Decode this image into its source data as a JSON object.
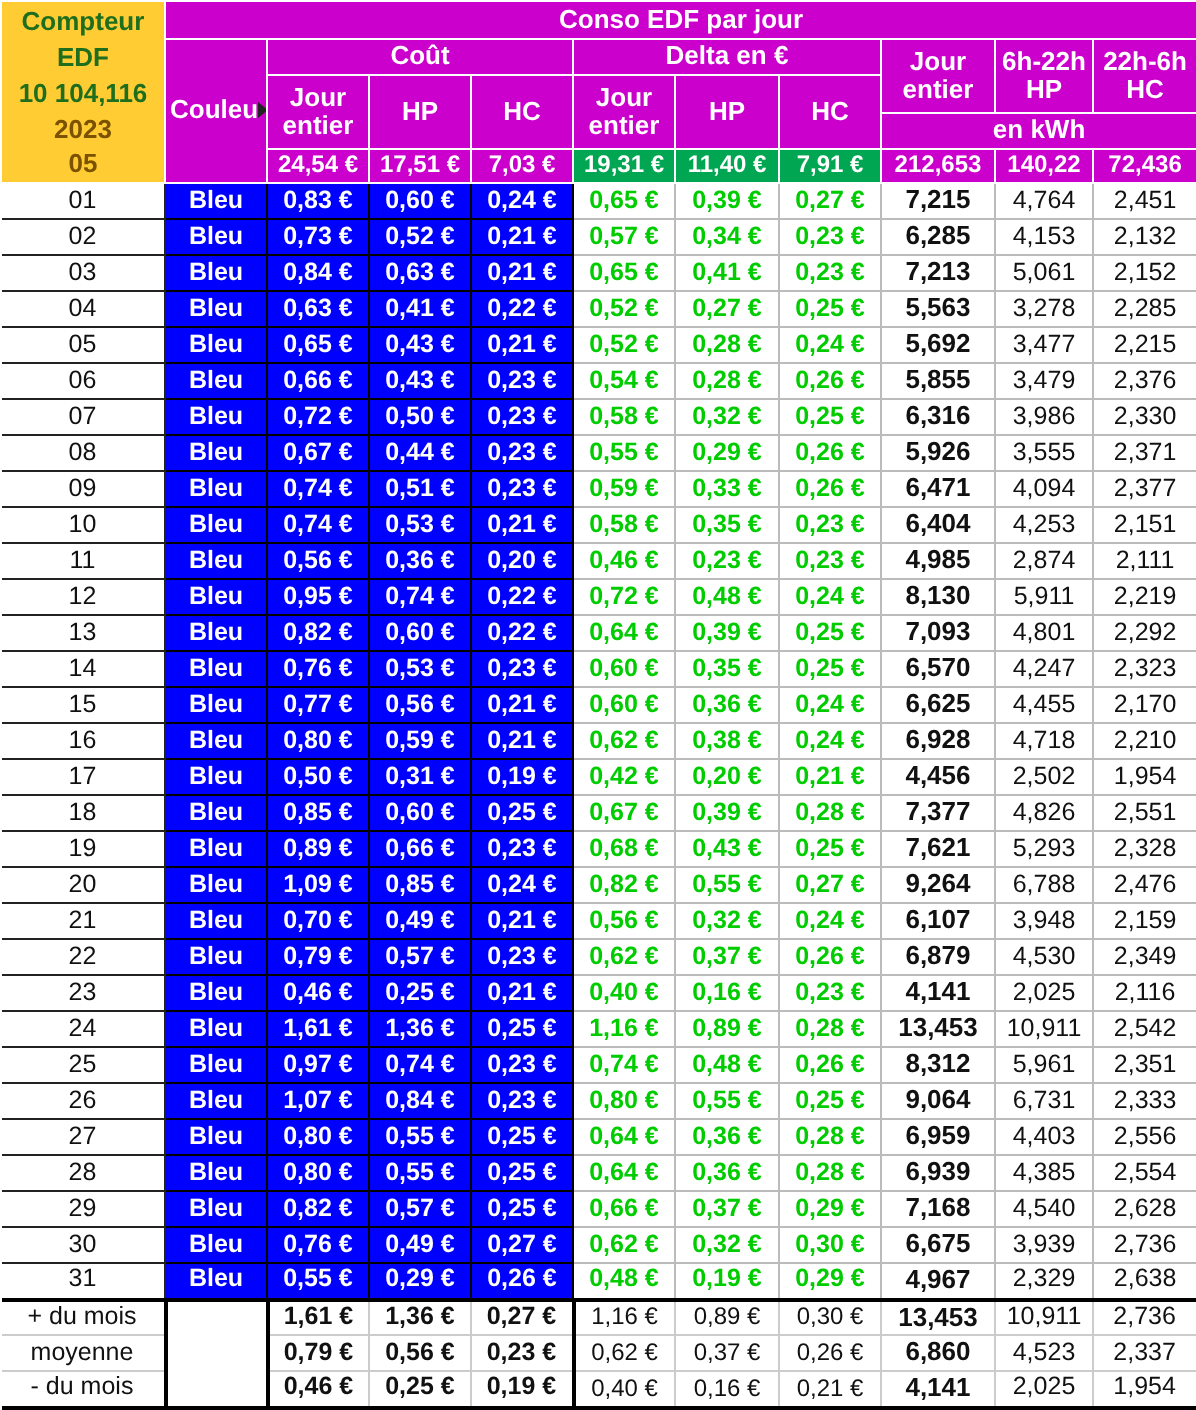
{
  "corner": {
    "title": "Compteur EDF",
    "meter": "10 104,116",
    "year": "2023",
    "month": "05"
  },
  "title": "Conso EDF par jour",
  "color_header": "Couleu",
  "groups": [
    {
      "label": "Coût",
      "columns": [
        "Jour entier",
        "HP",
        "HC"
      ],
      "totals": [
        "24,54 €",
        "17,51 €",
        "7,03 €"
      ]
    },
    {
      "label": "Delta en €",
      "columns": [
        "Jour entier",
        "HP",
        "HC"
      ],
      "totals": [
        "19,31 €",
        "11,40 €",
        "7,91 €"
      ]
    }
  ],
  "kwh": {
    "columns": [
      "Jour entier",
      "6h-22h HP",
      "22h-6h HC"
    ],
    "unit": "en kWh",
    "totals": [
      "212,653",
      "140,22",
      "72,436"
    ]
  },
  "rows": [
    {
      "day": "01",
      "tarif": "Bleu",
      "color": "#0000ff",
      "cout": [
        "0,83 €",
        "0,60 €",
        "0,24 €"
      ],
      "delta": [
        "0,65 €",
        "0,39 €",
        "0,27 €"
      ],
      "kwh": [
        "7,215",
        "4,764",
        "2,451"
      ]
    },
    {
      "day": "02",
      "tarif": "Bleu",
      "color": "#0000ff",
      "cout": [
        "0,73 €",
        "0,52 €",
        "0,21 €"
      ],
      "delta": [
        "0,57 €",
        "0,34 €",
        "0,23 €"
      ],
      "kwh": [
        "6,285",
        "4,153",
        "2,132"
      ]
    },
    {
      "day": "03",
      "tarif": "Bleu",
      "color": "#0000ff",
      "cout": [
        "0,84 €",
        "0,63 €",
        "0,21 €"
      ],
      "delta": [
        "0,65 €",
        "0,41 €",
        "0,23 €"
      ],
      "kwh": [
        "7,213",
        "5,061",
        "2,152"
      ]
    },
    {
      "day": "04",
      "tarif": "Bleu",
      "color": "#0000ff",
      "cout": [
        "0,63 €",
        "0,41 €",
        "0,22 €"
      ],
      "delta": [
        "0,52 €",
        "0,27 €",
        "0,25 €"
      ],
      "kwh": [
        "5,563",
        "3,278",
        "2,285"
      ]
    },
    {
      "day": "05",
      "tarif": "Bleu",
      "color": "#0000ff",
      "cout": [
        "0,65 €",
        "0,43 €",
        "0,21 €"
      ],
      "delta": [
        "0,52 €",
        "0,28 €",
        "0,24 €"
      ],
      "kwh": [
        "5,692",
        "3,477",
        "2,215"
      ]
    },
    {
      "day": "06",
      "tarif": "Bleu",
      "color": "#0000ff",
      "cout": [
        "0,66 €",
        "0,43 €",
        "0,23 €"
      ],
      "delta": [
        "0,54 €",
        "0,28 €",
        "0,26 €"
      ],
      "kwh": [
        "5,855",
        "3,479",
        "2,376"
      ]
    },
    {
      "day": "07",
      "tarif": "Bleu",
      "color": "#0000ff",
      "cout": [
        "0,72 €",
        "0,50 €",
        "0,23 €"
      ],
      "delta": [
        "0,58 €",
        "0,32 €",
        "0,25 €"
      ],
      "kwh": [
        "6,316",
        "3,986",
        "2,330"
      ]
    },
    {
      "day": "08",
      "tarif": "Bleu",
      "color": "#0000ff",
      "cout": [
        "0,67 €",
        "0,44 €",
        "0,23 €"
      ],
      "delta": [
        "0,55 €",
        "0,29 €",
        "0,26 €"
      ],
      "kwh": [
        "5,926",
        "3,555",
        "2,371"
      ]
    },
    {
      "day": "09",
      "tarif": "Bleu",
      "color": "#0000ff",
      "cout": [
        "0,74 €",
        "0,51 €",
        "0,23 €"
      ],
      "delta": [
        "0,59 €",
        "0,33 €",
        "0,26 €"
      ],
      "kwh": [
        "6,471",
        "4,094",
        "2,377"
      ]
    },
    {
      "day": "10",
      "tarif": "Bleu",
      "color": "#0000ff",
      "cout": [
        "0,74 €",
        "0,53 €",
        "0,21 €"
      ],
      "delta": [
        "0,58 €",
        "0,35 €",
        "0,23 €"
      ],
      "kwh": [
        "6,404",
        "4,253",
        "2,151"
      ]
    },
    {
      "day": "11",
      "tarif": "Bleu",
      "color": "#0000ff",
      "cout": [
        "0,56 €",
        "0,36 €",
        "0,20 €"
      ],
      "delta": [
        "0,46 €",
        "0,23 €",
        "0,23 €"
      ],
      "kwh": [
        "4,985",
        "2,874",
        "2,111"
      ]
    },
    {
      "day": "12",
      "tarif": "Bleu",
      "color": "#0000ff",
      "cout": [
        "0,95 €",
        "0,74 €",
        "0,22 €"
      ],
      "delta": [
        "0,72 €",
        "0,48 €",
        "0,24 €"
      ],
      "kwh": [
        "8,130",
        "5,911",
        "2,219"
      ]
    },
    {
      "day": "13",
      "tarif": "Bleu",
      "color": "#0000ff",
      "cout": [
        "0,82 €",
        "0,60 €",
        "0,22 €"
      ],
      "delta": [
        "0,64 €",
        "0,39 €",
        "0,25 €"
      ],
      "kwh": [
        "7,093",
        "4,801",
        "2,292"
      ]
    },
    {
      "day": "14",
      "tarif": "Bleu",
      "color": "#0000ff",
      "cout": [
        "0,76 €",
        "0,53 €",
        "0,23 €"
      ],
      "delta": [
        "0,60 €",
        "0,35 €",
        "0,25 €"
      ],
      "kwh": [
        "6,570",
        "4,247",
        "2,323"
      ]
    },
    {
      "day": "15",
      "tarif": "Bleu",
      "color": "#0000ff",
      "cout": [
        "0,77 €",
        "0,56 €",
        "0,21 €"
      ],
      "delta": [
        "0,60 €",
        "0,36 €",
        "0,24 €"
      ],
      "kwh": [
        "6,625",
        "4,455",
        "2,170"
      ]
    },
    {
      "day": "16",
      "tarif": "Bleu",
      "color": "#0000ff",
      "cout": [
        "0,80 €",
        "0,59 €",
        "0,21 €"
      ],
      "delta": [
        "0,62 €",
        "0,38 €",
        "0,24 €"
      ],
      "kwh": [
        "6,928",
        "4,718",
        "2,210"
      ]
    },
    {
      "day": "17",
      "tarif": "Bleu",
      "color": "#0000ff",
      "cout": [
        "0,50 €",
        "0,31 €",
        "0,19 €"
      ],
      "delta": [
        "0,42 €",
        "0,20 €",
        "0,21 €"
      ],
      "kwh": [
        "4,456",
        "2,502",
        "1,954"
      ]
    },
    {
      "day": "18",
      "tarif": "Bleu",
      "color": "#0000ff",
      "cout": [
        "0,85 €",
        "0,60 €",
        "0,25 €"
      ],
      "delta": [
        "0,67 €",
        "0,39 €",
        "0,28 €"
      ],
      "kwh": [
        "7,377",
        "4,826",
        "2,551"
      ]
    },
    {
      "day": "19",
      "tarif": "Bleu",
      "color": "#0000ff",
      "cout": [
        "0,89 €",
        "0,66 €",
        "0,23 €"
      ],
      "delta": [
        "0,68 €",
        "0,43 €",
        "0,25 €"
      ],
      "kwh": [
        "7,621",
        "5,293",
        "2,328"
      ]
    },
    {
      "day": "20",
      "tarif": "Bleu",
      "color": "#0000ff",
      "cout": [
        "1,09 €",
        "0,85 €",
        "0,24 €"
      ],
      "delta": [
        "0,82 €",
        "0,55 €",
        "0,27 €"
      ],
      "kwh": [
        "9,264",
        "6,788",
        "2,476"
      ]
    },
    {
      "day": "21",
      "tarif": "Bleu",
      "color": "#0000ff",
      "cout": [
        "0,70 €",
        "0,49 €",
        "0,21 €"
      ],
      "delta": [
        "0,56 €",
        "0,32 €",
        "0,24 €"
      ],
      "kwh": [
        "6,107",
        "3,948",
        "2,159"
      ]
    },
    {
      "day": "22",
      "tarif": "Bleu",
      "color": "#0000ff",
      "cout": [
        "0,79 €",
        "0,57 €",
        "0,23 €"
      ],
      "delta": [
        "0,62 €",
        "0,37 €",
        "0,26 €"
      ],
      "kwh": [
        "6,879",
        "4,530",
        "2,349"
      ]
    },
    {
      "day": "23",
      "tarif": "Bleu",
      "color": "#0000ff",
      "cout": [
        "0,46 €",
        "0,25 €",
        "0,21 €"
      ],
      "delta": [
        "0,40 €",
        "0,16 €",
        "0,23 €"
      ],
      "kwh": [
        "4,141",
        "2,025",
        "2,116"
      ]
    },
    {
      "day": "24",
      "tarif": "Bleu",
      "color": "#0000ff",
      "cout": [
        "1,61 €",
        "1,36 €",
        "0,25 €"
      ],
      "delta": [
        "1,16 €",
        "0,89 €",
        "0,28 €"
      ],
      "kwh": [
        "13,453",
        "10,911",
        "2,542"
      ]
    },
    {
      "day": "25",
      "tarif": "Bleu",
      "color": "#0000ff",
      "cout": [
        "0,97 €",
        "0,74 €",
        "0,23 €"
      ],
      "delta": [
        "0,74 €",
        "0,48 €",
        "0,26 €"
      ],
      "kwh": [
        "8,312",
        "5,961",
        "2,351"
      ]
    },
    {
      "day": "26",
      "tarif": "Bleu",
      "color": "#0000ff",
      "cout": [
        "1,07 €",
        "0,84 €",
        "0,23 €"
      ],
      "delta": [
        "0,80 €",
        "0,55 €",
        "0,25 €"
      ],
      "kwh": [
        "9,064",
        "6,731",
        "2,333"
      ]
    },
    {
      "day": "27",
      "tarif": "Bleu",
      "color": "#0000ff",
      "cout": [
        "0,80 €",
        "0,55 €",
        "0,25 €"
      ],
      "delta": [
        "0,64 €",
        "0,36 €",
        "0,28 €"
      ],
      "kwh": [
        "6,959",
        "4,403",
        "2,556"
      ]
    },
    {
      "day": "28",
      "tarif": "Bleu",
      "color": "#0000ff",
      "cout": [
        "0,80 €",
        "0,55 €",
        "0,25 €"
      ],
      "delta": [
        "0,64 €",
        "0,36 €",
        "0,28 €"
      ],
      "kwh": [
        "6,939",
        "4,385",
        "2,554"
      ]
    },
    {
      "day": "29",
      "tarif": "Bleu",
      "color": "#0000ff",
      "cout": [
        "0,82 €",
        "0,57 €",
        "0,25 €"
      ],
      "delta": [
        "0,66 €",
        "0,37 €",
        "0,29 €"
      ],
      "kwh": [
        "7,168",
        "4,540",
        "2,628"
      ]
    },
    {
      "day": "30",
      "tarif": "Bleu",
      "color": "#0000ff",
      "cout": [
        "0,76 €",
        "0,49 €",
        "0,27 €"
      ],
      "delta": [
        "0,62 €",
        "0,32 €",
        "0,30 €"
      ],
      "kwh": [
        "6,675",
        "3,939",
        "2,736"
      ]
    },
    {
      "day": "31",
      "tarif": "Bleu",
      "color": "#0000ff",
      "cout": [
        "0,55 €",
        "0,29 €",
        "0,26 €"
      ],
      "delta": [
        "0,48 €",
        "0,19 €",
        "0,29 €"
      ],
      "kwh": [
        "4,967",
        "2,329",
        "2,638"
      ]
    }
  ],
  "summary": [
    {
      "label": "+ du mois",
      "cout": [
        "1,61 €",
        "1,36 €",
        "0,27 €"
      ],
      "delta": [
        "1,16 €",
        "0,89 €",
        "0,30 €"
      ],
      "kwh": [
        "13,453",
        "10,911",
        "2,736"
      ]
    },
    {
      "label": "moyenne",
      "cout": [
        "0,79 €",
        "0,56 €",
        "0,23 €"
      ],
      "delta": [
        "0,62 €",
        "0,37 €",
        "0,26 €"
      ],
      "kwh": [
        "6,860",
        "4,523",
        "2,337"
      ]
    },
    {
      "label": "- du mois",
      "cout": [
        "0,46 €",
        "0,25 €",
        "0,19 €"
      ],
      "delta": [
        "0,40 €",
        "0,16 €",
        "0,21 €"
      ],
      "kwh": [
        "4,141",
        "2,025",
        "1,954"
      ]
    }
  ]
}
